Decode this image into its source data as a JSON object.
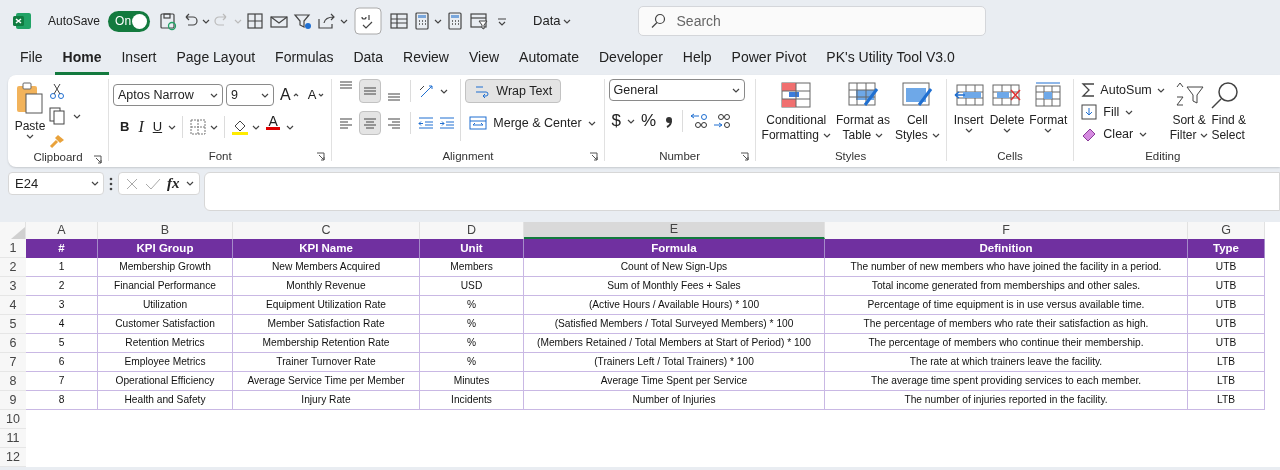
{
  "title_bar": {
    "autosave_label": "AutoSave",
    "autosave": {
      "label": "On",
      "on": true
    },
    "data_menu": "Data",
    "search_placeholder": "Search"
  },
  "menu_tabs": [
    {
      "label": "File",
      "selected": false
    },
    {
      "label": "Home",
      "selected": true
    },
    {
      "label": "Insert",
      "selected": false
    },
    {
      "label": "Page Layout",
      "selected": false
    },
    {
      "label": "Formulas",
      "selected": false
    },
    {
      "label": "Data",
      "selected": false
    },
    {
      "label": "Review",
      "selected": false
    },
    {
      "label": "View",
      "selected": false
    },
    {
      "label": "Automate",
      "selected": false
    },
    {
      "label": "Developer",
      "selected": false
    },
    {
      "label": "Help",
      "selected": false
    },
    {
      "label": "Power Pivot",
      "selected": false
    },
    {
      "label": "PK's Utility Tool V3.0",
      "selected": false
    }
  ],
  "ribbon": [
    {
      "kind": "clipboard",
      "name": "Clipboard",
      "paste_label": "Paste"
    },
    {
      "kind": "font",
      "name": "Font",
      "font_name": "Aptos Narrow",
      "font_size": "9",
      "grow_label": "A",
      "shrink_label": "A",
      "bold_label": "B",
      "italic_label": "I",
      "underline_label": "U",
      "color_label": "A"
    },
    {
      "kind": "alignment",
      "name": "Alignment",
      "middle_on": true,
      "center_on": true,
      "wrap_text": {
        "label": "Wrap Text",
        "on": true
      },
      "merge_label": "Merge & Center"
    },
    {
      "kind": "number",
      "name": "Number",
      "format": "General",
      "currency_label": "$",
      "percent_label": "%"
    },
    {
      "kind": "styles",
      "name": "Styles",
      "buttons": [
        {
          "lines": [
            "Conditional",
            "Formatting"
          ]
        },
        {
          "lines": [
            "Format as",
            "Table"
          ]
        },
        {
          "lines": [
            "Cell",
            "Styles"
          ]
        }
      ]
    },
    {
      "kind": "cells",
      "name": "Cells",
      "buttons": [
        {
          "label": "Insert"
        },
        {
          "label": "Delete"
        },
        {
          "label": "Format"
        }
      ]
    },
    {
      "kind": "editing",
      "name": "Editing",
      "autosum": "AutoSum",
      "fill": "Fill",
      "clear": "Clear",
      "sort_lines": [
        "Sort &",
        "Filter"
      ],
      "find_lines": [
        "Find &",
        "Select"
      ]
    }
  ],
  "formula_bar": {
    "name_box": "E24",
    "function_label": "fx"
  },
  "sheet": {
    "columns": [
      {
        "label": "A",
        "selected": false
      },
      {
        "label": "B",
        "selected": false
      },
      {
        "label": "C",
        "selected": false
      },
      {
        "label": "D",
        "selected": false
      },
      {
        "label": "E",
        "selected": true
      },
      {
        "label": "F",
        "selected": false
      },
      {
        "label": "G",
        "selected": false
      }
    ],
    "row_numbers": [
      "1",
      "2",
      "3",
      "4",
      "5",
      "6",
      "7",
      "8",
      "9",
      "10",
      "11",
      "12"
    ],
    "header": [
      "#",
      "KPI Group",
      "KPI Name",
      "Unit",
      "Formula",
      "Definition",
      "Type"
    ],
    "rows": [
      [
        "1",
        "Membership Growth",
        "New Members Acquired",
        "Members",
        "Count of New Sign-Ups",
        "The number of new members who have joined the facility in a period.",
        "UTB"
      ],
      [
        "2",
        "Financial Performance",
        "Monthly Revenue",
        "USD",
        "Sum of Monthly Fees + Sales",
        "Total income generated from memberships and other sales.",
        "UTB"
      ],
      [
        "3",
        "Utilization",
        "Equipment Utilization Rate",
        "%",
        "(Active Hours / Available Hours) * 100",
        "Percentage of time equipment is in use versus available time.",
        "UTB"
      ],
      [
        "4",
        "Customer Satisfaction",
        "Member Satisfaction Rate",
        "%",
        "(Satisfied Members / Total Surveyed Members) * 100",
        "The percentage of members who rate their satisfaction as high.",
        "UTB"
      ],
      [
        "5",
        "Retention Metrics",
        "Membership Retention Rate",
        "%",
        "(Members Retained / Total Members at Start of Period) * 100",
        "The percentage of members who continue their membership.",
        "UTB"
      ],
      [
        "6",
        "Employee Metrics",
        "Trainer Turnover Rate",
        "%",
        "(Trainers Left / Total Trainers) * 100",
        "The rate at which trainers leave the facility.",
        "LTB"
      ],
      [
        "7",
        "Operational Efficiency",
        "Average Service Time per Member",
        "Minutes",
        "Average Time Spent per Service",
        "The average time spent providing services to each member.",
        "LTB"
      ],
      [
        "8",
        "Health and Safety",
        "Injury Rate",
        "Incidents",
        "Number of Injuries",
        "The number of injuries reported in the facility.",
        "LTB"
      ]
    ]
  }
}
